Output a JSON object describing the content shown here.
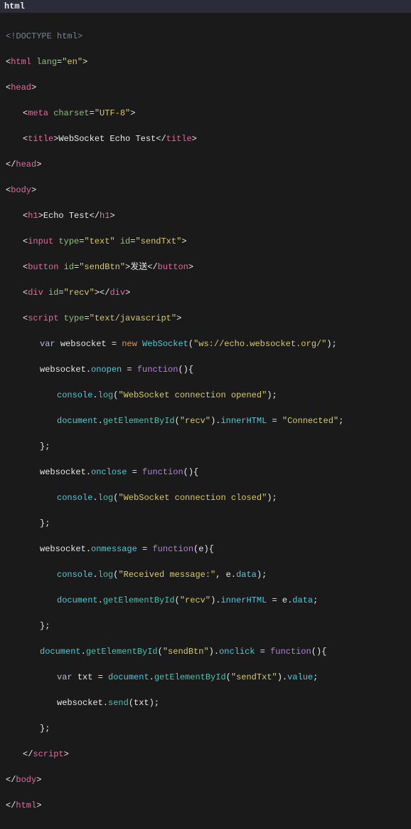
{
  "header": {
    "title": "html"
  },
  "code": {
    "doctype": "<!DOCTYPE html>",
    "html_open": {
      "tag": "html",
      "attr": "lang",
      "val": "\"en\""
    },
    "head_open": "head",
    "meta": {
      "tag": "meta",
      "attr": "charset",
      "val": "\"UTF-8\""
    },
    "title": {
      "tag": "title",
      "text": "WebSocket Echo Test"
    },
    "head_close": "head",
    "body_open": "body",
    "h1": {
      "tag": "h1",
      "text": "Echo Test"
    },
    "input": {
      "tag": "input",
      "a1": "type",
      "v1": "\"text\"",
      "a2": "id",
      "v2": "\"sendTxt\""
    },
    "button": {
      "tag": "button",
      "a1": "id",
      "v1": "\"sendBtn\"",
      "text": "发送"
    },
    "div": {
      "tag": "div",
      "a1": "id",
      "v1": "\"recv\""
    },
    "script_open": {
      "tag": "script",
      "a1": "type",
      "v1": "\"text/javascript\""
    },
    "js": {
      "l1_var": "var",
      "l1_ws": "websocket",
      "l1_eq": " = ",
      "l1_new": "new",
      "l1_ctor": "WebSocket",
      "l1_arg": "\"ws://echo.websocket.org/\"",
      "l2_ws": "websocket",
      "l2_prop": "onopen",
      "l2_fn": "function",
      "l3_console": "console",
      "l3_log": "log",
      "l3_arg": "\"WebSocket connection opened\"",
      "l4_doc": "document",
      "l4_get": "getElementById",
      "l4_arg": "\"recv\"",
      "l4_inner": "innerHTML",
      "l4_val": "\"Connected\"",
      "l6_ws": "websocket",
      "l6_prop": "onclose",
      "l6_fn": "function",
      "l7_console": "console",
      "l7_log": "log",
      "l7_arg": "\"WebSocket connection closed\"",
      "l9_ws": "websocket",
      "l9_prop": "onmessage",
      "l9_fn": "function",
      "l9_param": "e",
      "l10_console": "console",
      "l10_log": "log",
      "l10_arg": "\"Received message:\"",
      "l10_e": "e",
      "l10_data": "data",
      "l11_doc": "document",
      "l11_get": "getElementById",
      "l11_arg": "\"recv\"",
      "l11_inner": "innerHTML",
      "l11_e": "e",
      "l11_data": "data",
      "l13_doc": "document",
      "l13_get": "getElementById",
      "l13_arg": "\"sendBtn\"",
      "l13_onclick": "onclick",
      "l13_fn": "function",
      "l14_var": "var",
      "l14_txt": "txt",
      "l14_doc": "document",
      "l14_get": "getElementById",
      "l14_arg": "\"sendTxt\"",
      "l14_value": "value",
      "l15_ws": "websocket",
      "l15_send": "send",
      "l15_txt": "txt",
      "close_br": "};"
    },
    "script_close": "script",
    "body_close": "body",
    "html_close": "html"
  }
}
